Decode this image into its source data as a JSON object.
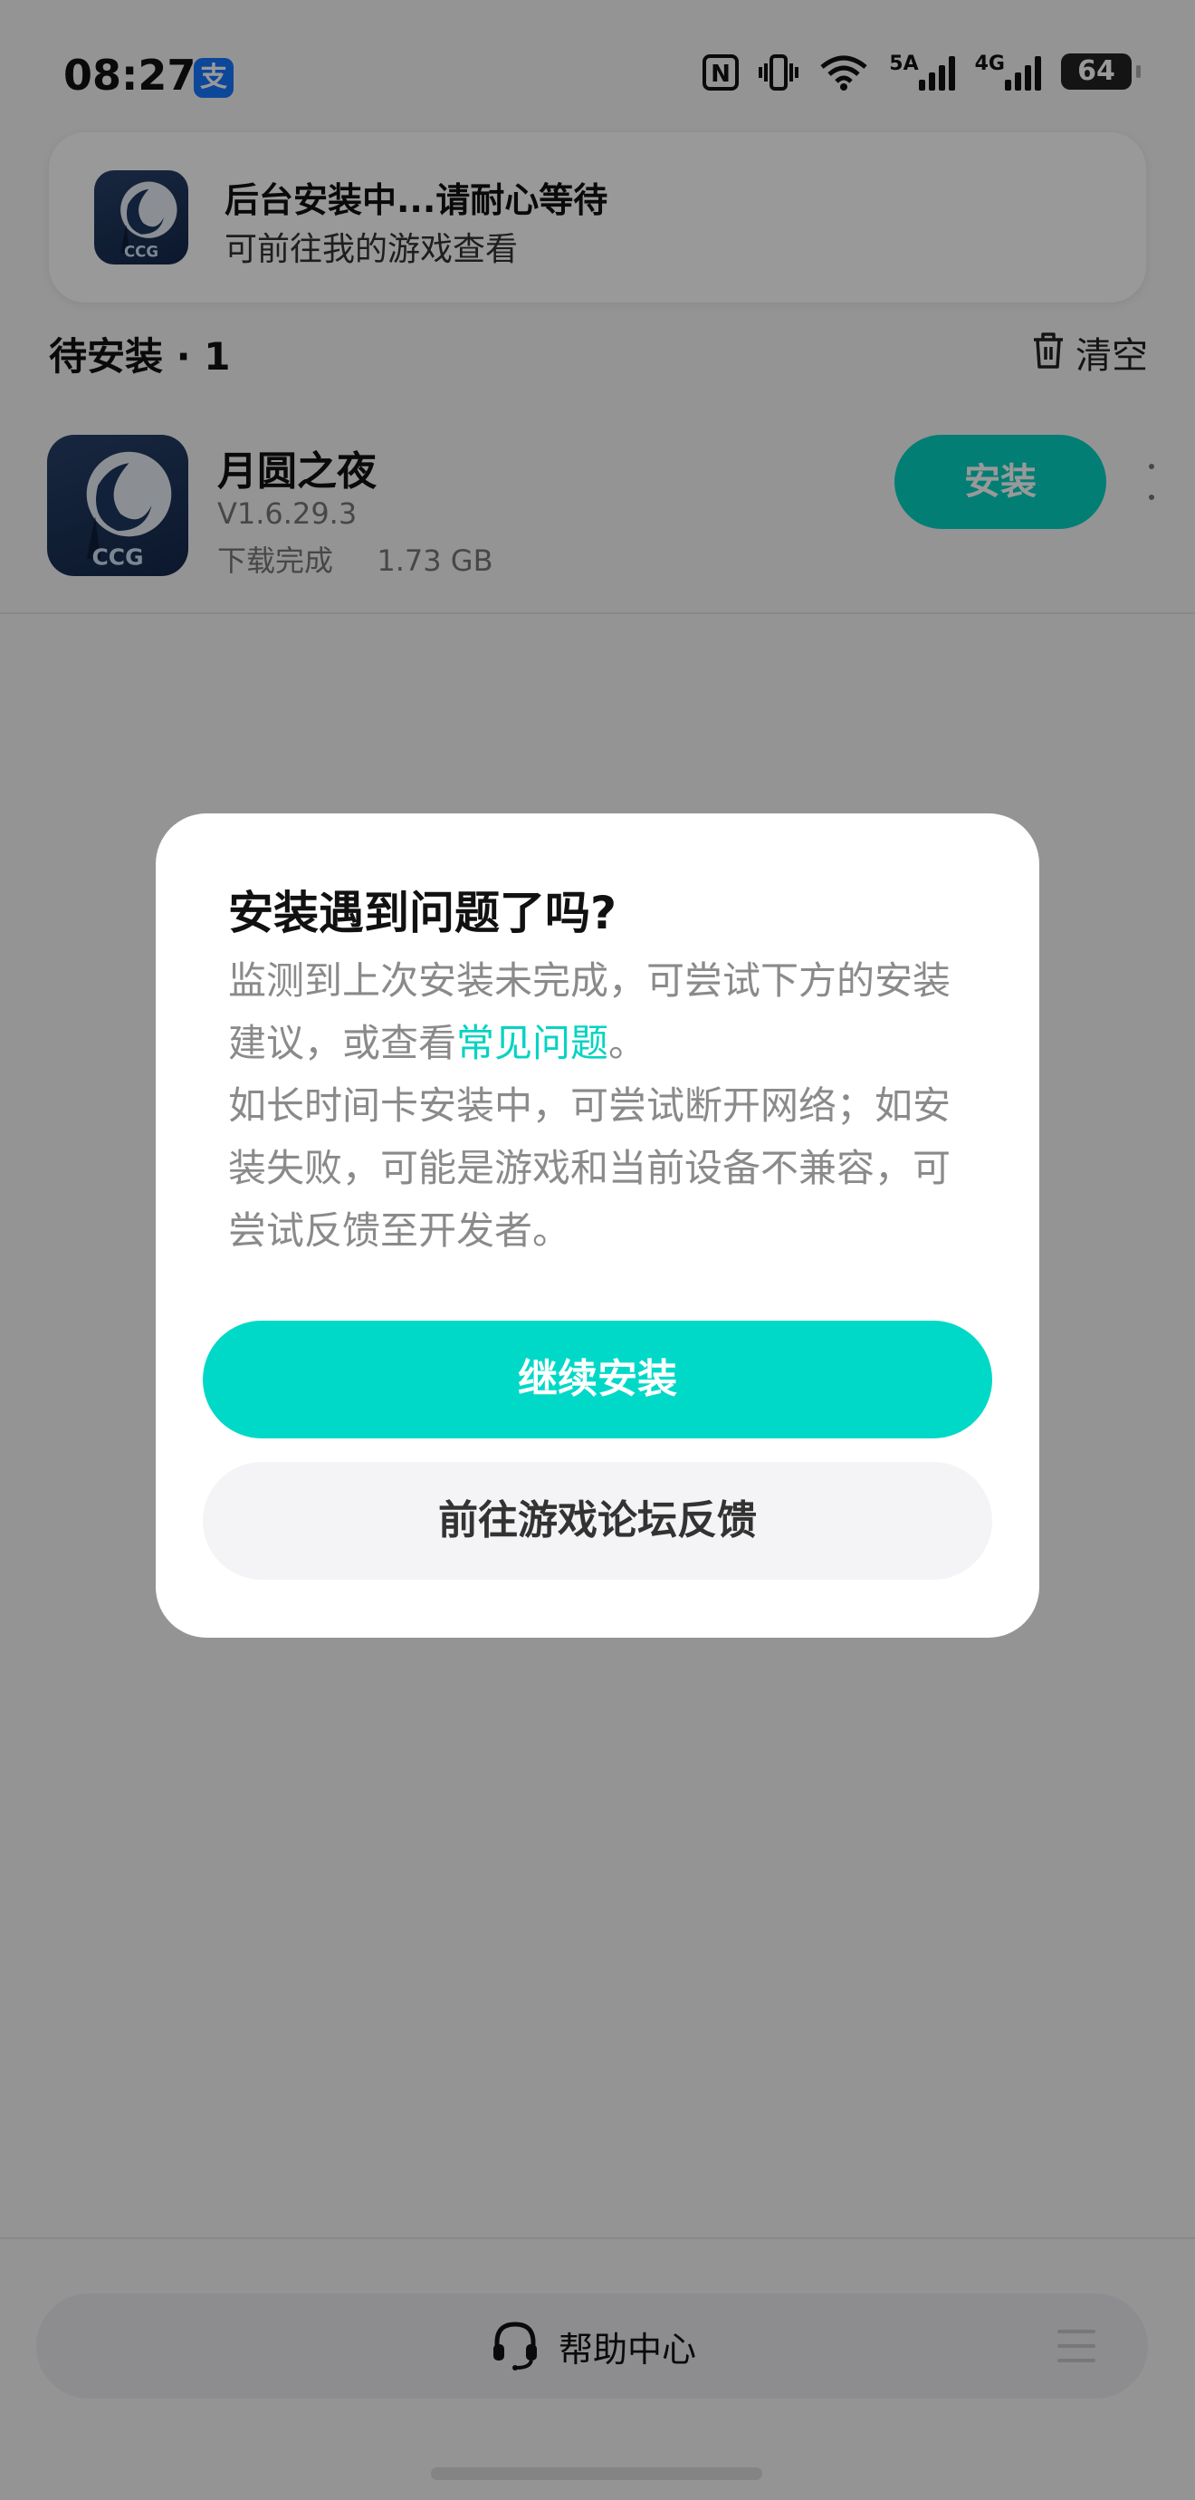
{
  "status_bar": {
    "time": "08:27",
    "alipay_glyph": "支",
    "nfc_label": "N",
    "net_5g": "5A",
    "net_4g": "4G",
    "battery": "64"
  },
  "toast": {
    "title": "后台安装中...请耐心等待",
    "subtitle": "可前往我的游戏查看"
  },
  "pending": {
    "header": "待安装 · 1",
    "clear_label": "清空"
  },
  "game": {
    "name": "月圆之夜",
    "version": "V1.6.29.3",
    "status": "下载完成",
    "size": "1.73 GB",
    "install_label": "安装",
    "icon_text": "CCG"
  },
  "dialog": {
    "title": "安装遇到问题了吗?",
    "line1": "监测到上次安装未完成，可尝试下方的安装建议，或查看",
    "link": "常见问题",
    "link_end": "。",
    "line2": "如长时间卡安装中，可尝试断开网络；如安装失败，可能是游戏和当前设备不兼容，可尝试反馈至开发者。",
    "primary_label": "继续安装",
    "secondary_label": "前往游戏论坛反馈"
  },
  "bottom": {
    "help_label": "帮助中心"
  },
  "colors": {
    "accent": "#00d9c7",
    "install_button": "#06d3c2",
    "overlay": "rgba(0,0,0,0.40)"
  }
}
